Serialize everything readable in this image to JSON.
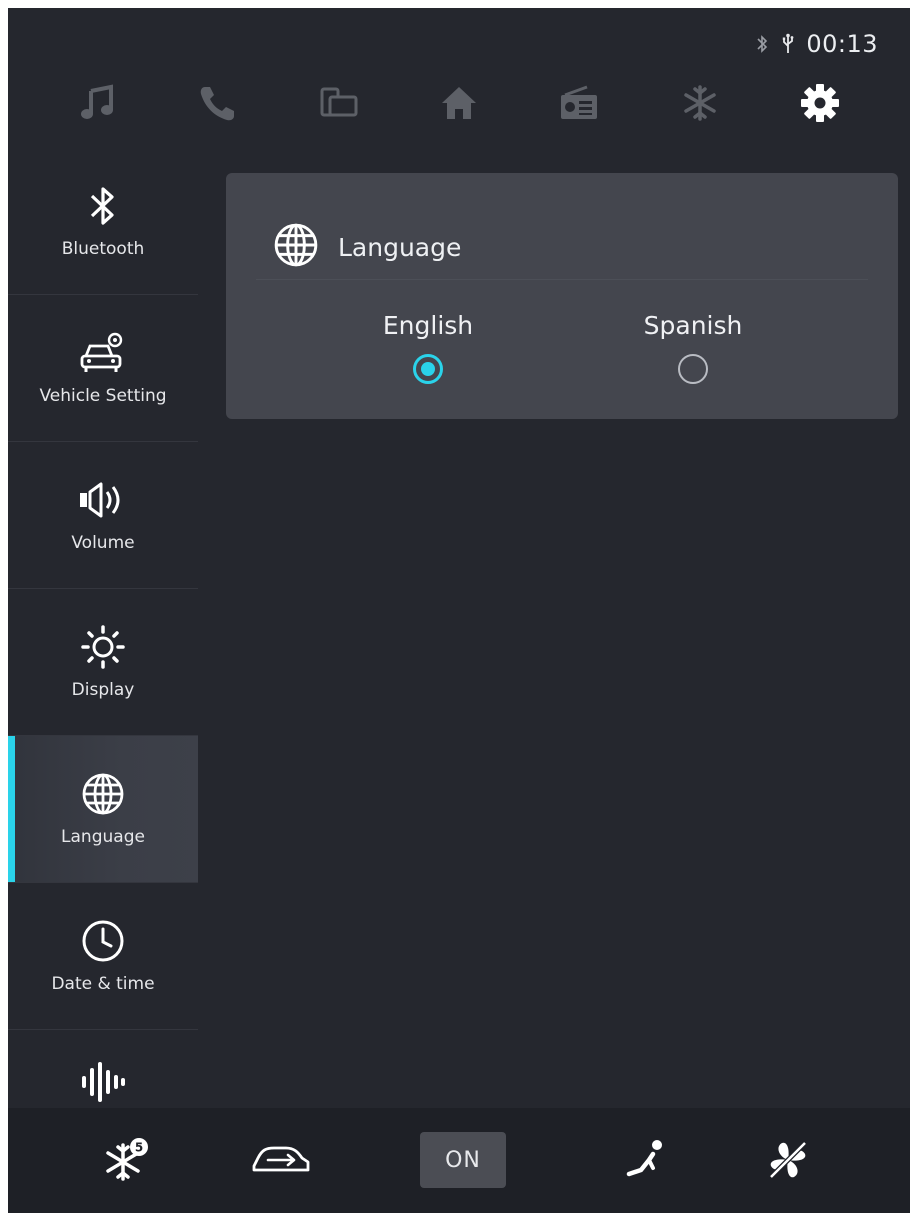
{
  "status_bar": {
    "bluetooth_icon": "bluetooth-icon",
    "usb_icon": "usb-icon",
    "time": "00:13"
  },
  "top_nav": [
    {
      "id": "music",
      "icon": "music-note-icon"
    },
    {
      "id": "phone",
      "icon": "phone-icon"
    },
    {
      "id": "mirror",
      "icon": "screen-mirror-icon"
    },
    {
      "id": "home",
      "icon": "home-icon"
    },
    {
      "id": "radio",
      "icon": "radio-icon"
    },
    {
      "id": "climate",
      "icon": "snowflake-icon"
    },
    {
      "id": "settings",
      "icon": "gear-icon",
      "active": true
    }
  ],
  "sidebar": {
    "items": [
      {
        "label": "Bluetooth",
        "icon": "bluetooth-icon"
      },
      {
        "label": "Vehicle Setting",
        "icon": "car-settings-icon"
      },
      {
        "label": "Volume",
        "icon": "speaker-icon"
      },
      {
        "label": "Display",
        "icon": "brightness-icon"
      },
      {
        "label": "Language",
        "icon": "globe-icon",
        "active": true
      },
      {
        "label": "Date & time",
        "icon": "clock-icon"
      },
      {
        "label": "",
        "icon": "sound-wave-icon"
      }
    ]
  },
  "language_panel": {
    "title": "Language",
    "icon": "globe-icon",
    "options": [
      {
        "label": "English",
        "selected": true
      },
      {
        "label": "Spanish",
        "selected": false
      }
    ]
  },
  "bottom_bar": {
    "defrost_badge": "5",
    "on_label": "ON",
    "icons": [
      "defrost-icon",
      "car-recirculation-icon",
      "on-button",
      "seat-heat-icon",
      "fan-off-icon"
    ]
  },
  "colors": {
    "accent": "#2ad3ea",
    "background": "#25272e",
    "panel": "#44464e",
    "bottom_bar": "#1e2026"
  }
}
